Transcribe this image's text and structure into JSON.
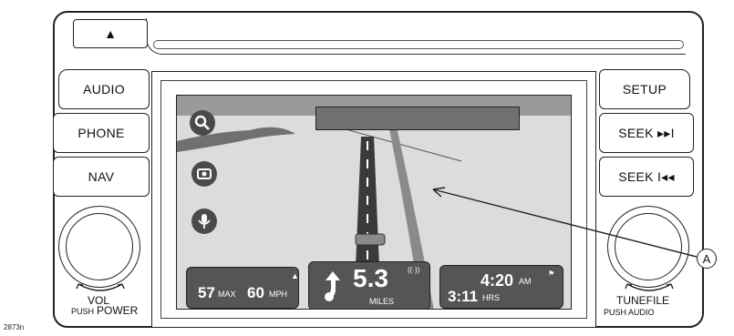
{
  "figure_id": "2873n",
  "eject_symbol": "▲",
  "left_buttons": [
    {
      "label": "AUDIO"
    },
    {
      "label": "PHONE"
    },
    {
      "label": "NAV"
    }
  ],
  "right_buttons": [
    {
      "label": "SETUP"
    },
    {
      "label": "SEEK ▸▸I"
    },
    {
      "label": "SEEK I◂◂"
    }
  ],
  "left_knob": {
    "label_top": "VOL",
    "label_push": "PUSH",
    "label_main": "POWER"
  },
  "right_knob": {
    "label_main": "TUNEFILE",
    "label_push": "PUSH AUDIO"
  },
  "callout": {
    "letter": "A"
  },
  "screen": {
    "icons": [
      {
        "name": "search-icon"
      },
      {
        "name": "camera-icon"
      },
      {
        "name": "microphone-icon"
      }
    ],
    "speed_box": {
      "limit": "57",
      "limit_unit": "MAX",
      "speed": "60",
      "speed_unit": "MPH"
    },
    "turn_box": {
      "distance": "5.3",
      "distance_unit": "MILES"
    },
    "eta_box": {
      "arrival": "4:20",
      "arrival_suffix": "AM",
      "remaining": "3:11",
      "remaining_unit": "HRS"
    }
  },
  "colors": {
    "screen_bg": "#dcdcdc",
    "road": "#444444",
    "box": "#555555",
    "sky": "#9a9a9a"
  }
}
